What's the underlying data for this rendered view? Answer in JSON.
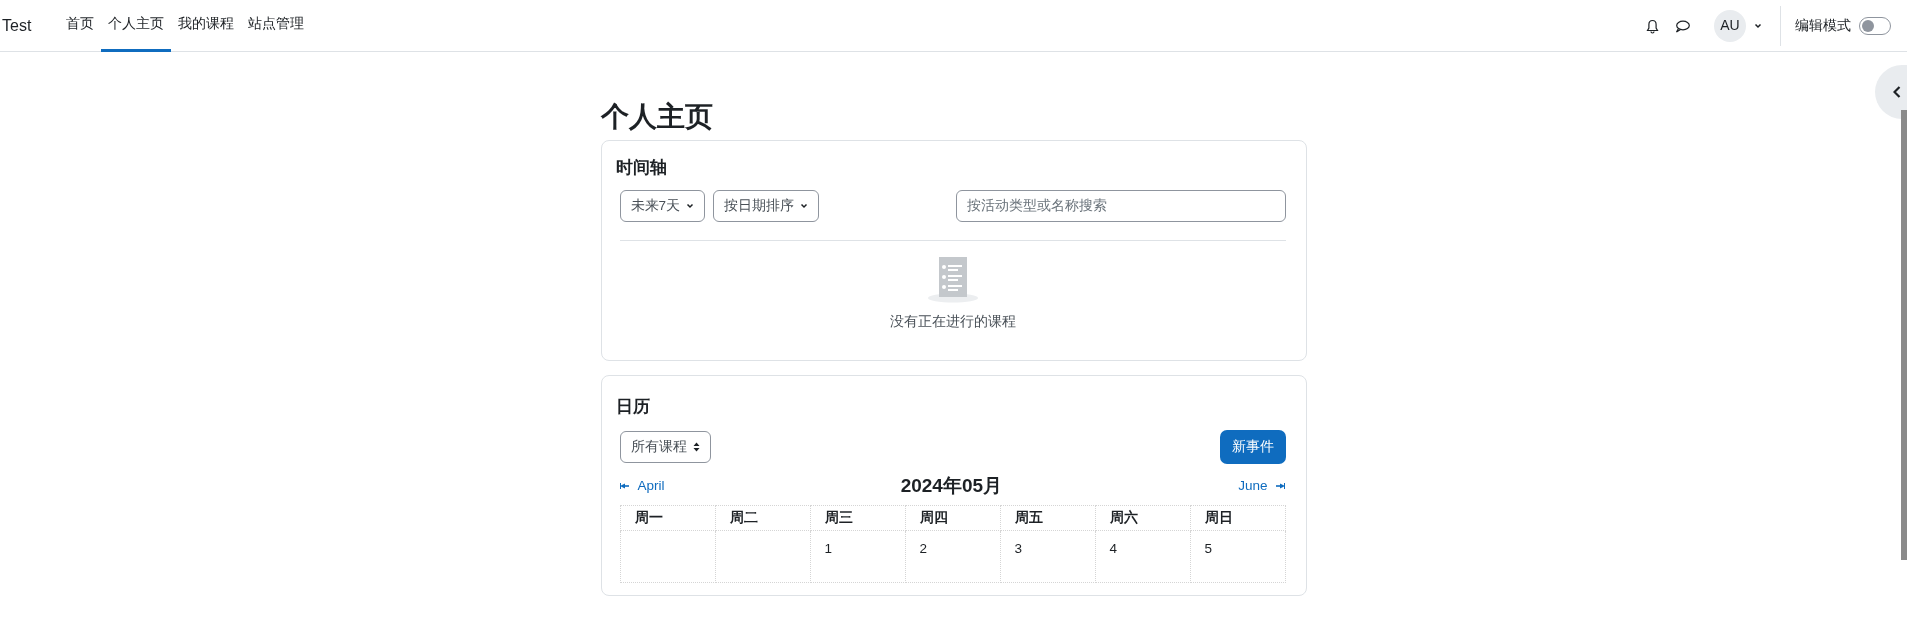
{
  "navbar": {
    "brand": "Test",
    "items": [
      {
        "label": "首页",
        "selected": false
      },
      {
        "label": "个人主页",
        "selected": true
      },
      {
        "label": "我的课程",
        "selected": false
      },
      {
        "label": "站点管理",
        "selected": false
      }
    ],
    "avatar": "AU",
    "edit_mode": {
      "label": "编辑模式",
      "on": false
    }
  },
  "page_title": "个人主页",
  "timeline": {
    "title": "时间轴",
    "filters": [
      "未来7天",
      "按日期排序"
    ],
    "search": {
      "placeholder": "按活动类型或名称搜索"
    },
    "empty_message": "没有正在进行的课程"
  },
  "calendar": {
    "title": "日历",
    "course_select": "所有课程",
    "new_event_button": "新事件",
    "prev_month": "April",
    "next_month": "June",
    "month_title": "2024年05月",
    "weekdays": [
      "周一",
      "周二",
      "周三",
      "周四",
      "周五",
      "周六",
      "周日"
    ],
    "weeks": [
      [
        {
          "kind": "blank"
        },
        {
          "kind": "blank"
        },
        {
          "kind": "day",
          "day": "1"
        },
        {
          "kind": "day",
          "day": "2"
        },
        {
          "kind": "day",
          "day": "3"
        },
        {
          "kind": "day",
          "day": "4"
        },
        {
          "kind": "day",
          "day": "5"
        }
      ]
    ]
  }
}
